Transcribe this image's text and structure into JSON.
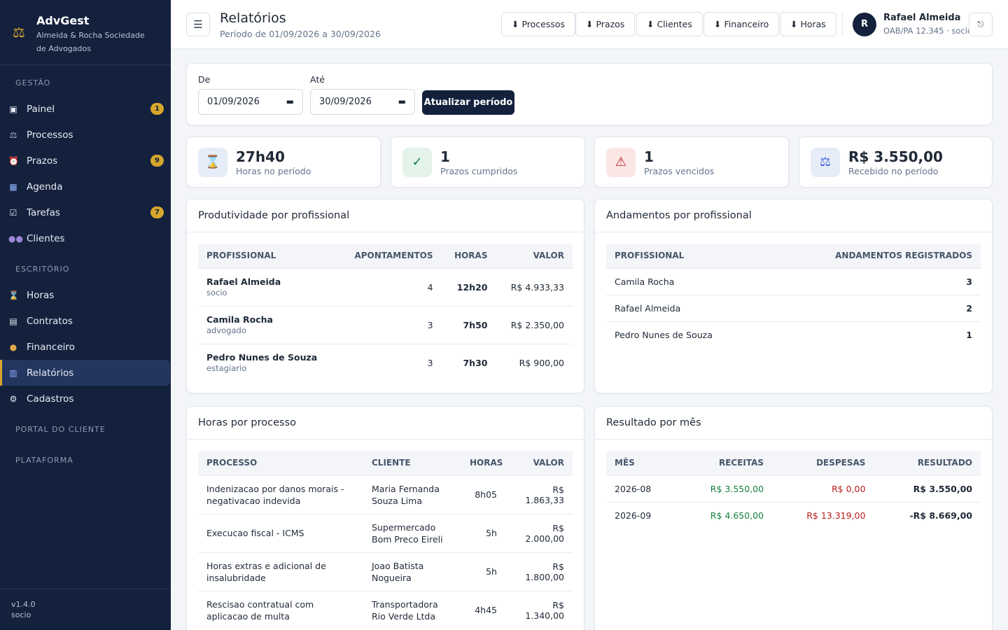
{
  "app": {
    "name": "AdvGest",
    "firm": "Almeida & Rocha Sociedade de Advogados",
    "version": "v1.4.0",
    "role": "socio"
  },
  "sidebar": {
    "sections": {
      "gestao": "GESTÃO",
      "escritorio": "ESCRITÓRIO",
      "portal": "PORTAL DO CLIENTE",
      "plataforma": "PLATAFORMA"
    },
    "gestao_items": [
      {
        "label": "Painel",
        "icon": "dashboard-icon",
        "badge": "1"
      },
      {
        "label": "Processos",
        "icon": "cases-icon",
        "badge": ""
      },
      {
        "label": "Prazos",
        "icon": "alarm-clock-icon",
        "badge": "9"
      },
      {
        "label": "Agenda",
        "icon": "calendar-icon",
        "badge": ""
      },
      {
        "label": "Tarefas",
        "icon": "checkbox-icon",
        "badge": "7"
      },
      {
        "label": "Clientes",
        "icon": "users-icon",
        "badge": ""
      }
    ],
    "escritorio_items": [
      {
        "label": "Horas",
        "icon": "hourglass-icon"
      },
      {
        "label": "Contratos",
        "icon": "document-icon"
      },
      {
        "label": "Financeiro",
        "icon": "money-bag-icon"
      },
      {
        "label": "Relatórios",
        "icon": "bar-chart-icon",
        "active": true
      },
      {
        "label": "Cadastros",
        "icon": "gear-icon"
      }
    ]
  },
  "topbar": {
    "title": "Relatórios",
    "period": "Período de 01/09/2026 a 30/09/2026",
    "exports": [
      "⬇ Processos",
      "⬇ Prazos",
      "⬇ Clientes",
      "⬇ Financeiro",
      "⬇ Horas"
    ],
    "user": {
      "initial": "R",
      "name": "Rafael Almeida",
      "role": "OAB/PA 12.345 · socio"
    }
  },
  "filter": {
    "from_label": "De",
    "from_value": "01/09/2026",
    "to_label": "Até",
    "to_value": "30/09/2026",
    "button": "Atualizar período"
  },
  "stats": [
    {
      "value": "27h40",
      "label": "Horas no período",
      "icon": "hourglass-icon",
      "bg": "#e6edf8"
    },
    {
      "value": "1",
      "label": "Prazos cumpridos",
      "icon": "check-icon",
      "bg": "#e3f3ea"
    },
    {
      "value": "1",
      "label": "Prazos vencidos",
      "icon": "warning-icon",
      "bg": "#fbe6e6"
    },
    {
      "value": "R$ 3.550,00",
      "label": "Recebido no período",
      "icon": "scales-icon",
      "bg": "#e6edf8"
    }
  ],
  "productivity": {
    "title": "Produtividade por profissional",
    "headers": [
      "PROFISSIONAL",
      "APONTAMENTOS",
      "HORAS",
      "VALOR"
    ],
    "rows": [
      {
        "name": "Rafael Almeida",
        "role": "socio",
        "count": "4",
        "hours": "12h20",
        "value": "R$ 4.933,33"
      },
      {
        "name": "Camila Rocha",
        "role": "advogado",
        "count": "3",
        "hours": "7h50",
        "value": "R$ 2.350,00"
      },
      {
        "name": "Pedro Nunes de Souza",
        "role": "estagiario",
        "count": "3",
        "hours": "7h30",
        "value": "R$ 900,00"
      }
    ]
  },
  "andamentos": {
    "title": "Andamentos por profissional",
    "headers": [
      "PROFISSIONAL",
      "ANDAMENTOS REGISTRADOS"
    ],
    "rows": [
      {
        "name": "Camila Rocha",
        "count": "3"
      },
      {
        "name": "Rafael Almeida",
        "count": "2"
      },
      {
        "name": "Pedro Nunes de Souza",
        "count": "1"
      }
    ]
  },
  "hours_by_case": {
    "title": "Horas por processo",
    "headers": [
      "PROCESSO",
      "CLIENTE",
      "HORAS",
      "VALOR"
    ],
    "rows": [
      {
        "process": "Indenizacao por danos morais - negativacao indevida",
        "client": "Maria Fernanda Souza Lima",
        "hours": "8h05",
        "value": "R$ 1.863,33"
      },
      {
        "process": "Execucao fiscal - ICMS",
        "client": "Supermercado Bom Preco Eireli",
        "hours": "5h",
        "value": "R$ 2.000,00"
      },
      {
        "process": "Horas extras e adicional de insalubridade",
        "client": "Joao Batista Nogueira",
        "hours": "5h",
        "value": "R$ 1.800,00"
      },
      {
        "process": "Rescisao contratual com aplicacao de multa",
        "client": "Transportadora Rio Verde Ltda",
        "hours": "4h45",
        "value": "R$ 1.340,00"
      }
    ]
  },
  "monthly": {
    "title": "Resultado por mês",
    "headers": [
      "MÊS",
      "RECEITAS",
      "DESPESAS",
      "RESULTADO"
    ],
    "rows": [
      {
        "month": "2026-08",
        "income": "R$ 3.550,00",
        "expense": "R$ 0,00",
        "result": "R$ 3.550,00"
      },
      {
        "month": "2026-09",
        "income": "R$ 4.650,00",
        "expense": "R$ 13.319,00",
        "result": "-R$ 8.669,00"
      }
    ]
  }
}
